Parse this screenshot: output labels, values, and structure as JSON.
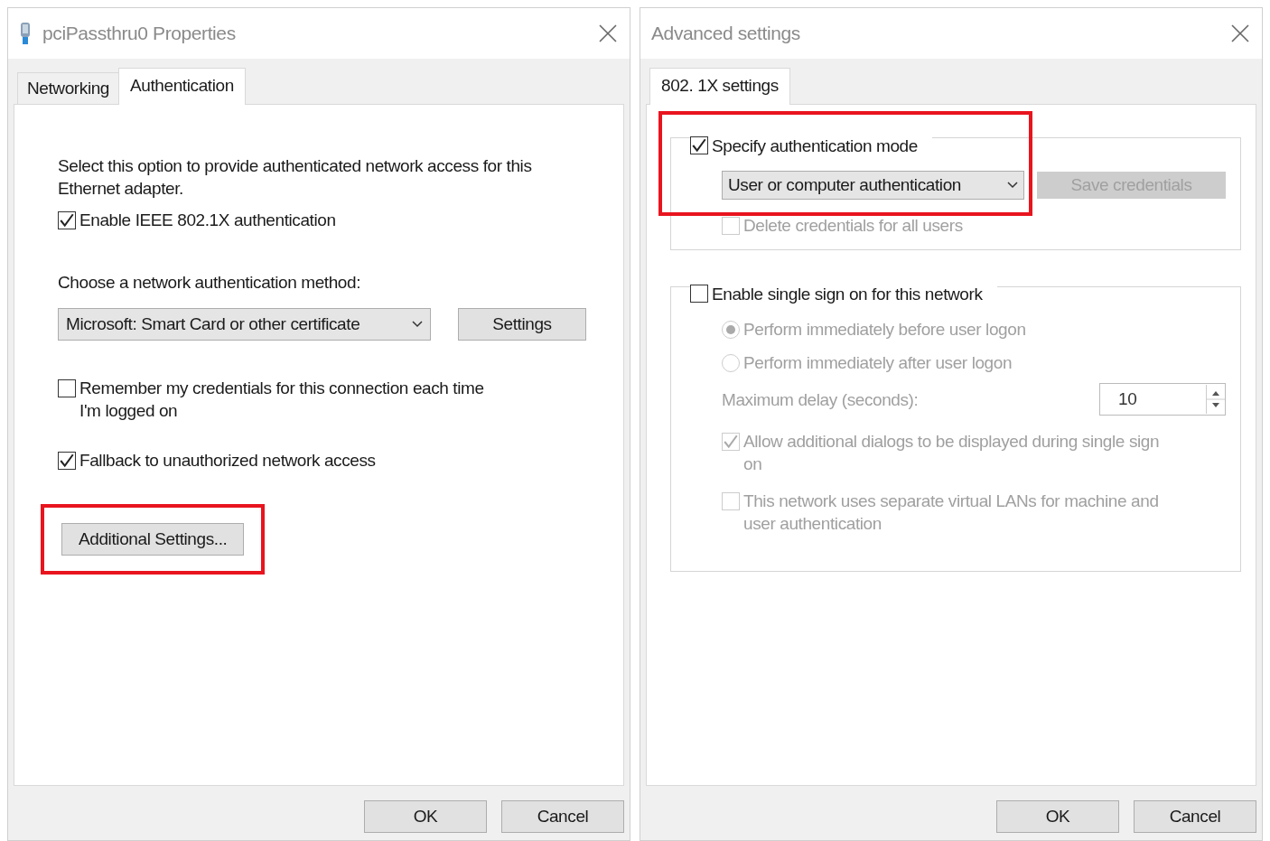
{
  "left_window": {
    "title": "pciPassthru0 Properties",
    "tabs": [
      {
        "label": "Networking",
        "selected": false
      },
      {
        "label": "Authentication",
        "selected": true
      }
    ],
    "description": "Select this option to provide authenticated network access for this Ethernet adapter.",
    "enable_8021x": {
      "label": "Enable IEEE 802.1X authentication",
      "checked": true
    },
    "method_label": "Choose a network authentication method:",
    "method_select": {
      "value": "Microsoft: Smart Card or other certificate"
    },
    "settings_button": "Settings",
    "remember_credentials": {
      "label": "Remember my credentials for this connection each time I'm logged on",
      "checked": false
    },
    "fallback": {
      "label": "Fallback to unauthorized network access",
      "checked": true
    },
    "additional_settings": {
      "label": "Additional Settings...",
      "highlighted": true
    },
    "buttons": [
      "OK",
      "Cancel"
    ]
  },
  "right_window": {
    "title": "Advanced settings",
    "tabs": [
      {
        "label": "802. 1X settings",
        "selected": true
      }
    ],
    "specify_mode": {
      "label": "Specify authentication mode",
      "checked": true,
      "highlighted": true
    },
    "mode_select": {
      "value": "User or computer authentication"
    },
    "save_credentials": {
      "label": "Save credentials",
      "disabled": true
    },
    "delete_credentials": {
      "label": "Delete credentials for all users",
      "checked": false,
      "disabled": true
    },
    "single_sign_on": {
      "label": "Enable single sign on for this network",
      "checked": false
    },
    "sso_options": [
      {
        "kind": "radio",
        "label": "Perform immediately before user logon",
        "selected": true,
        "disabled": true
      },
      {
        "kind": "radio",
        "label": "Perform immediately after user logon",
        "selected": false,
        "disabled": true
      }
    ],
    "max_delay": {
      "label": "Maximum delay (seconds):",
      "value": "10",
      "disabled": true
    },
    "sso_checks": [
      {
        "label": "Allow additional dialogs to be displayed during single sign on",
        "checked": true,
        "disabled": true
      },
      {
        "label": "This network uses separate virtual LANs for machine and user authentication",
        "checked": false,
        "disabled": true
      }
    ],
    "buttons": [
      "OK",
      "Cancel"
    ]
  }
}
